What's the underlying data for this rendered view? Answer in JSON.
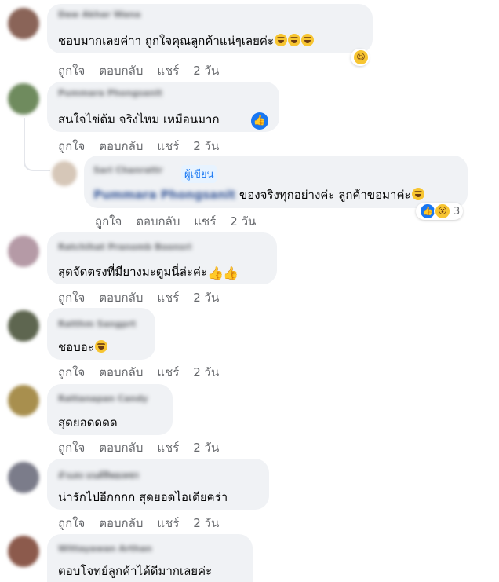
{
  "actions": {
    "like": "ถูกใจ",
    "reply": "ตอบกลับ",
    "share": "แชร์",
    "time": "2 วัน"
  },
  "comments": [
    {
      "author": "Daw Akhar Wana",
      "text": "ชอบมากเลยค่าา ถูกใจคุณลูกค้าแน่ๆเลยค่ะ"
    },
    {
      "author": "Pummara Phongsanit",
      "text": "สนใจไข่ต้ม จริงไหม เหมือนมาก"
    },
    {
      "author": "Sari Chanrattr",
      "author_badge": "ผู้เขียน",
      "mention": "Pummara Phongsanit",
      "text": "ของจริงทุกอย่างค่ะ ลูกค้าขอมาค่ะ",
      "reaction_count": "3"
    },
    {
      "author": "Ratchihat Pranomb Boonsri",
      "text": "สุดจัดตรงที่มียางมะตูมนี่ล่ะค่ะ"
    },
    {
      "author": "Ratthm Sangprt",
      "text": "ชอบอะ"
    },
    {
      "author": "Rattanapan Candy",
      "text": "สุดยอดดดด"
    },
    {
      "author": "ลำแสง มนต์ทิพยเพชร",
      "text": "น่ารักไปอีกกกก สุดยอดไอเดียคร่า"
    },
    {
      "author": "Wittayawan Arthan",
      "text": "ตอบโจทย์ลูกค้าได้ดีมากเลยค่ะ"
    }
  ]
}
